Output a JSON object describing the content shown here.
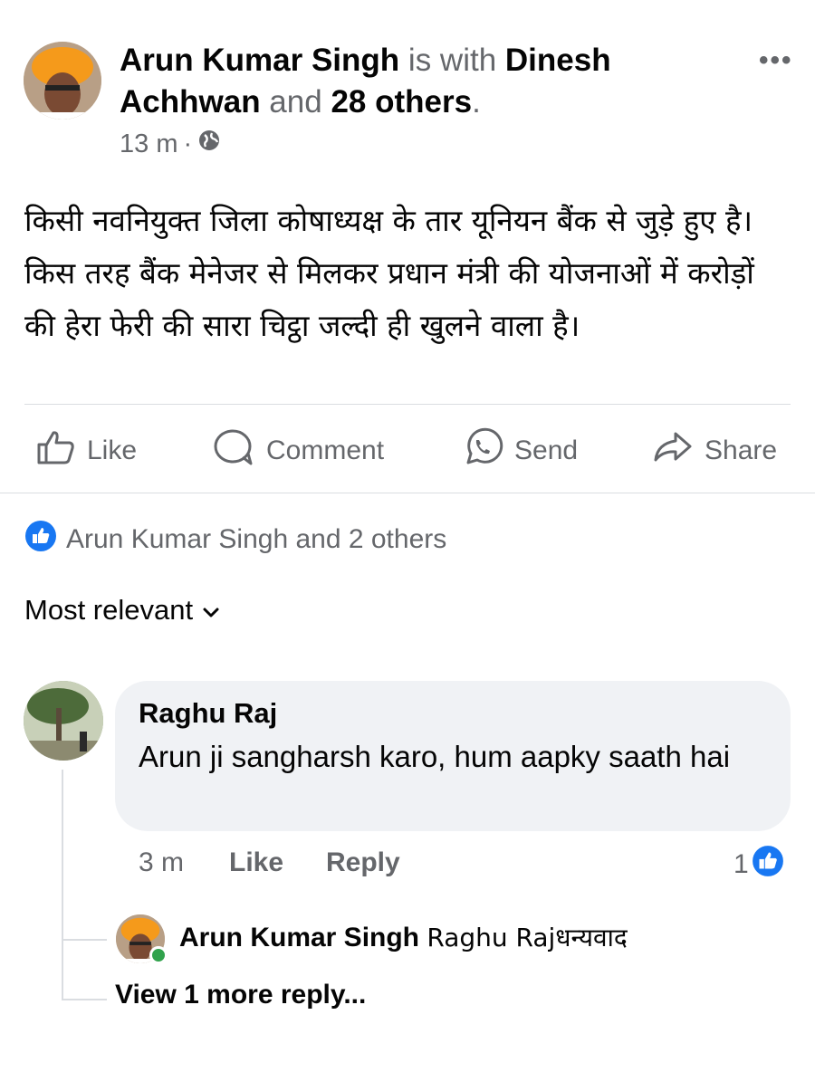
{
  "post": {
    "author": "Arun Kumar Singh",
    "with_text": " is with ",
    "tagged": "Dinesh Achhwan",
    "and_text": " and ",
    "others": "28 others",
    "period": ".",
    "time": "13 m",
    "separator": "·",
    "text": "किसी नवनियुक्त जिला कोषाध्यक्ष के तार यूनियन बैंक से जुड़े हुए है। किस तरह  बैंक मेनेजर से मिलकर प्रधान मंत्री की योजनाओं में करोड़ों की हेरा फेरी की सारा चिट्ठा जल्दी ही खुलने वाला है।"
  },
  "actions": {
    "like": "Like",
    "comment": "Comment",
    "send": "Send",
    "share": "Share"
  },
  "reactions_summary": "Arun Kumar Singh and 2 others",
  "sort_label": "Most relevant",
  "comment": {
    "author": "Raghu Raj",
    "text": "Arun ji sangharsh karo, hum aapky saath hai",
    "time": "3 m",
    "like": "Like",
    "reply": "Reply",
    "reaction_count": "1"
  },
  "reply": {
    "author": "Arun Kumar Singh",
    "text": "Raghu Rajधन्यवाद"
  },
  "view_more": "View 1 more reply...",
  "colors": {
    "like_blue": "#1877f2",
    "secondary_text": "#65676b",
    "bubble_bg": "#f0f2f5"
  }
}
